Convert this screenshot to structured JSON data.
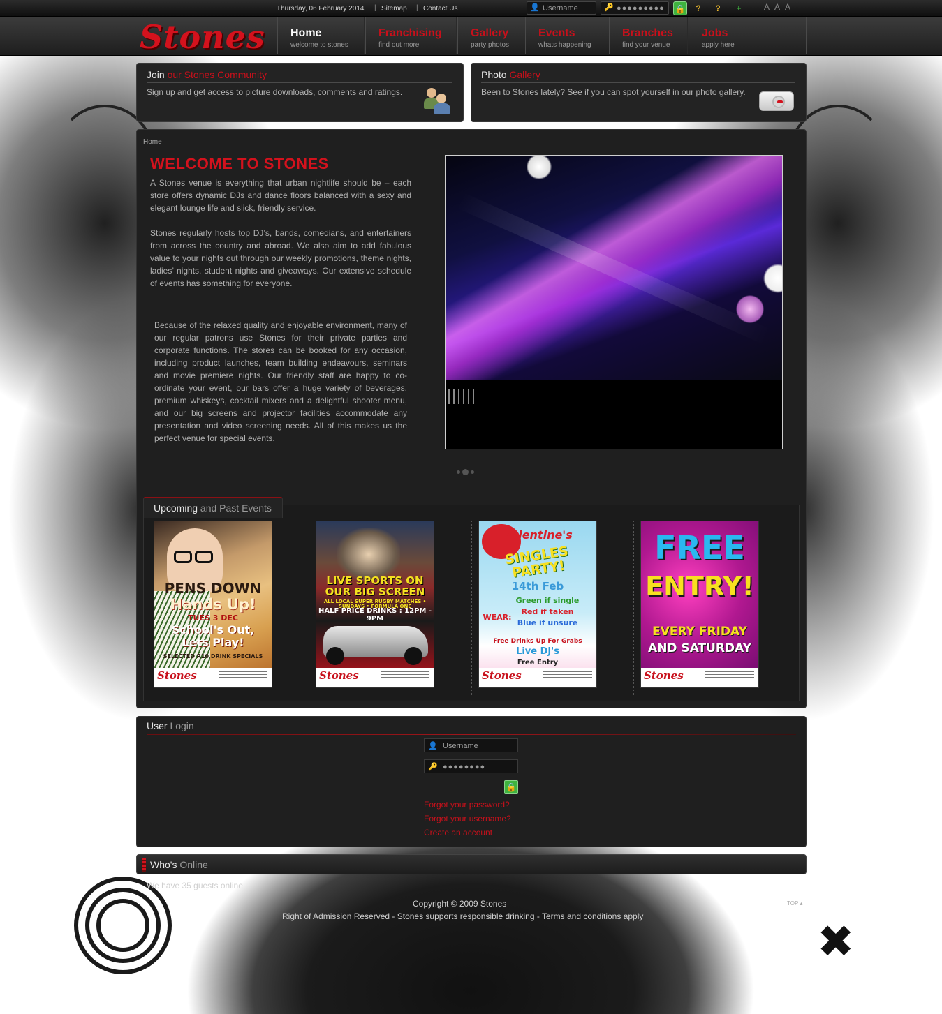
{
  "topbar": {
    "date": "Thursday, 06 February 2014",
    "links": [
      "Sitemap",
      "Contact Us"
    ],
    "username_placeholder": "Username",
    "password_mask": "●●●●●●●●●",
    "font_controls": [
      "A",
      "A",
      "A"
    ]
  },
  "brand": {
    "logo_text": "Stones",
    "accent_color": "#c8101b"
  },
  "nav": [
    {
      "title": "Home",
      "subtitle": "welcome to stones"
    },
    {
      "title": "Franchising",
      "subtitle": "find out more"
    },
    {
      "title": "Gallery",
      "subtitle": "party photos"
    },
    {
      "title": "Events",
      "subtitle": "whats happening"
    },
    {
      "title": "Branches",
      "subtitle": "find your venue"
    },
    {
      "title": "Jobs",
      "subtitle": "apply here"
    }
  ],
  "community": {
    "title_prefix": "Join",
    "title_highlight": "our Stones Community",
    "text": "Sign up and get access to picture downloads, comments and ratings."
  },
  "photo_gallery": {
    "title_prefix": "Photo",
    "title_highlight": "Gallery",
    "text": "Been to Stones lately? See if you can spot yourself in our photo gallery."
  },
  "breadcrumb": "Home",
  "welcome": {
    "heading": "WELCOME TO STONES",
    "para1": "A Stones venue is everything that urban nightlife should be – each store offers dynamic DJs and dance floors balanced with a sexy and elegant lounge life and slick, friendly service.",
    "para2": "Stones regularly hosts top DJ’s, bands, comedians, and entertainers from across the country and abroad. We also aim to add fabulous value to your nights out through our weekly promotions, theme nights, ladies’ nights, student nights and giveaways. Our extensive schedule of events has something for everyone.",
    "para3": "Because of the relaxed quality and enjoyable environment, many of our regular patrons use Stones for their private parties and corporate functions. The stores can be booked for any occasion, including product launches, team building endeavours, seminars and movie premiere nights. Our friendly staff are happy to co-ordinate your event, our bars offer a huge variety of beverages, premium whiskeys, cocktail mixers and a delightful shooter menu, and our big screens and projector facilities accommodate any presentation and video screening needs. All of this makes us the perfect venue for special events."
  },
  "events": {
    "title_prefix": "Upcoming",
    "title_rest": "and Past Events",
    "posters": [
      {
        "lines": [
          "PENS DOWN",
          "Hands Up!",
          "TUES 3 DEC",
          "School's Out,",
          "Lets Play!",
          "SELECTED R10 DRINK SPECIALS"
        ]
      },
      {
        "lines": [
          "LIVE SPORTS ON OUR BIG SCREEN",
          "ALL LOCAL SUPER RUGBY MATCHES • SUNDAYS • FORMULA ONE",
          "HALF PRICE DRINKS : 12PM - 9PM"
        ]
      },
      {
        "lines": [
          "Valentine's",
          "SINGLES PARTY!",
          "14th Feb",
          "WEAR:",
          "Green if single",
          "Red if taken",
          "Blue if unsure",
          "Free Drinks Up For Grabs",
          "Live DJ's",
          "Free Entry"
        ]
      },
      {
        "lines": [
          "FREE",
          "ENTRY!",
          "EVERY FRIDAY",
          "AND SATURDAY"
        ]
      }
    ],
    "poster_brand": "Stones"
  },
  "login": {
    "title_prefix": "User",
    "title_rest": "Login",
    "username_placeholder": "Username",
    "password_mask": "●●●●●●●●",
    "links": [
      "Forgot your password?",
      "Forgot your username?",
      "Create an account"
    ]
  },
  "whos_online": {
    "title_prefix": "Who's",
    "title_rest": "Online",
    "text": "We have 35 guests online"
  },
  "footer": {
    "copyright": "Copyright © 2009 Stones",
    "notice": "Right of Admission Reserved -  Stones supports responsible drinking - Terms and conditions apply",
    "top_link": "TOP"
  }
}
